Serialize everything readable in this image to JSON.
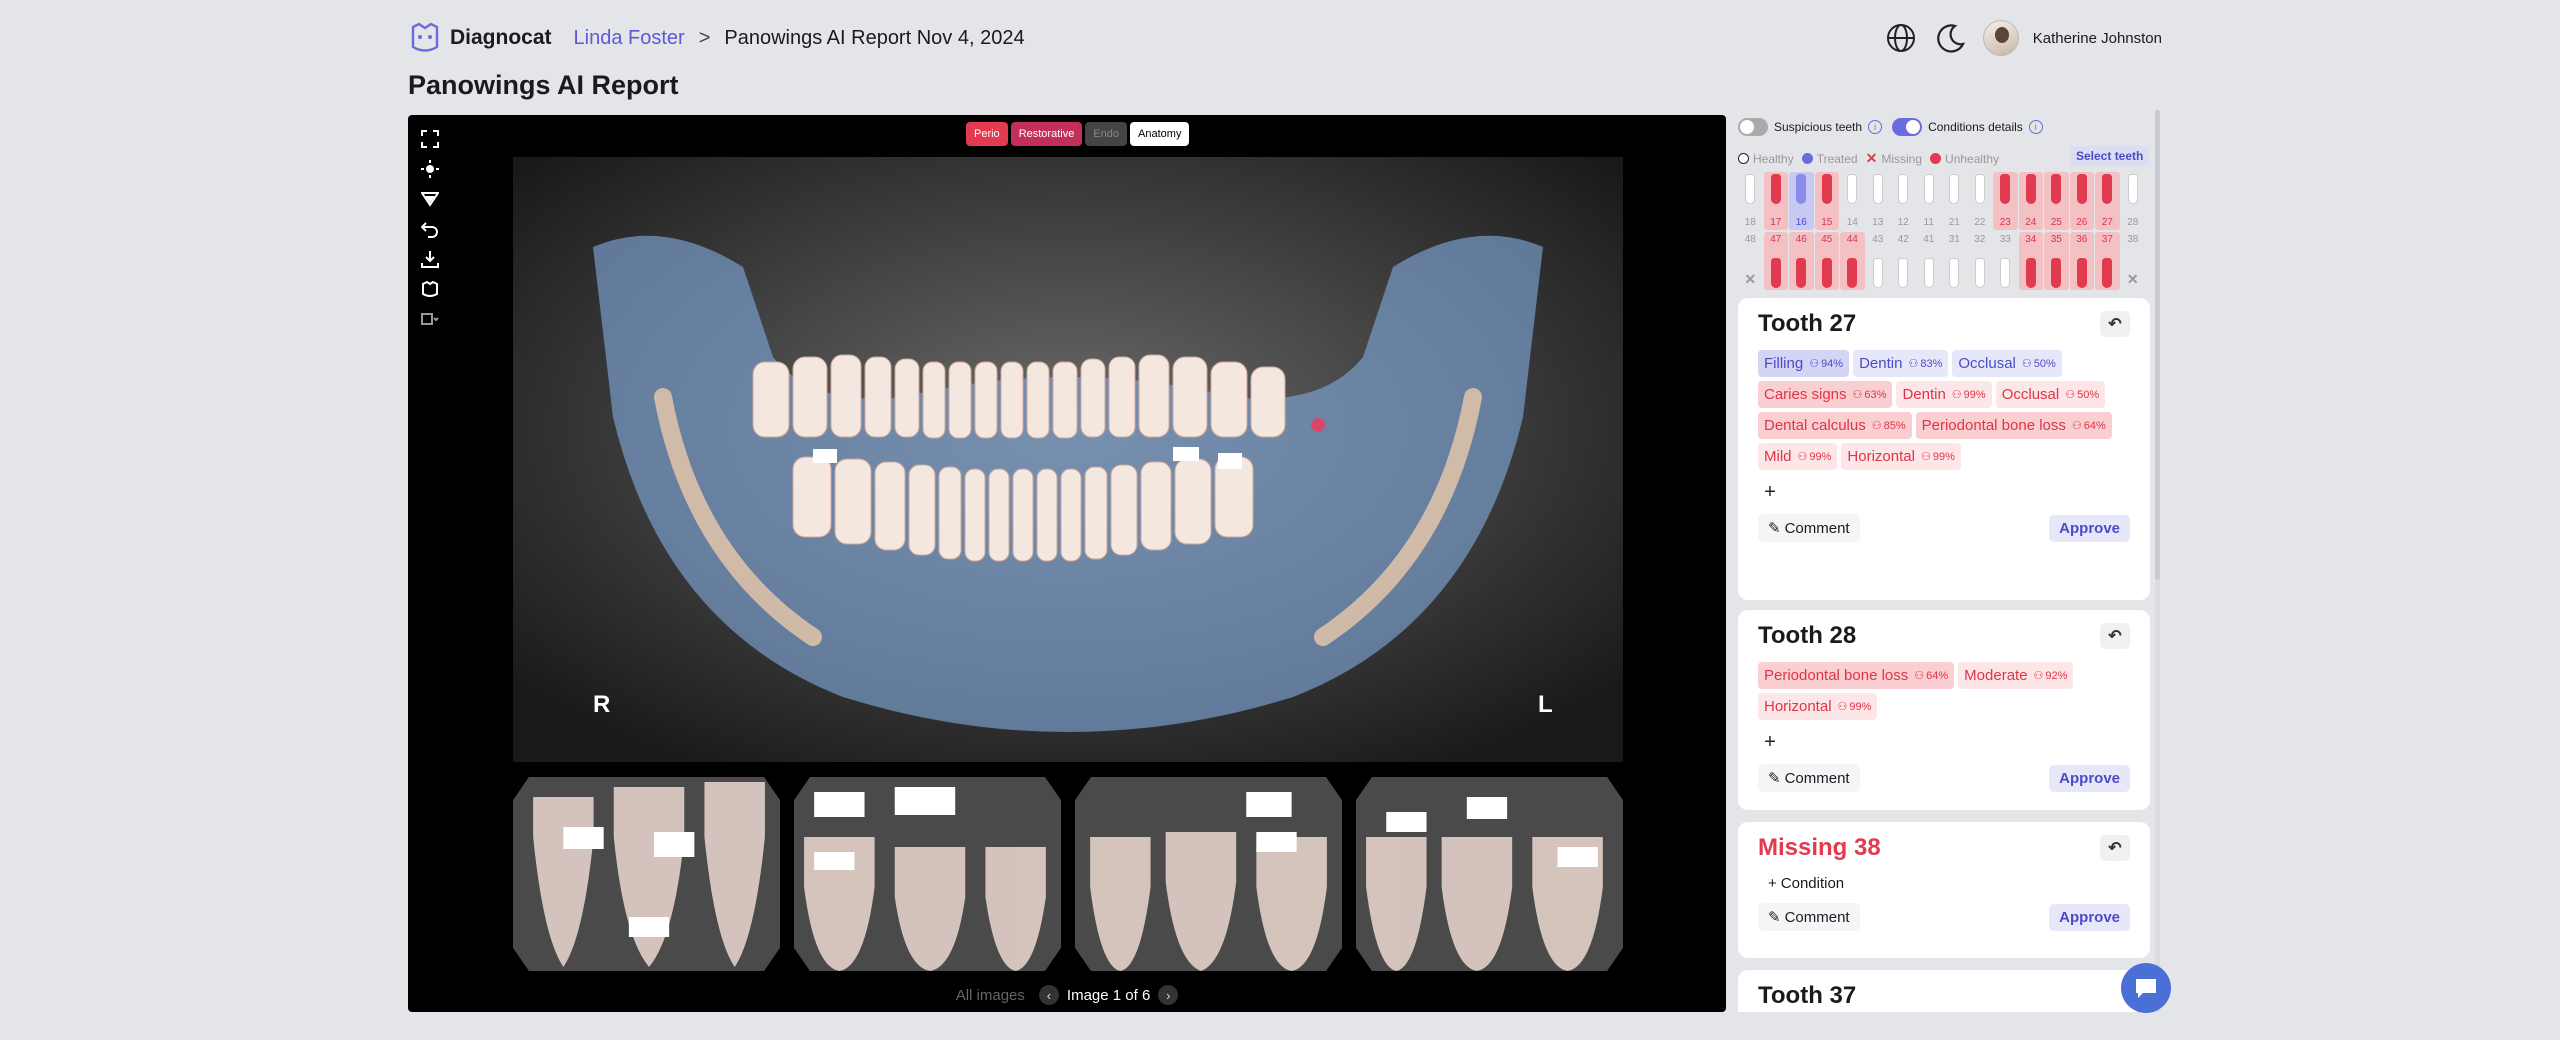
{
  "header": {
    "brand": "Diagnocat",
    "patient": "Linda Foster",
    "separator": ">",
    "report_crumb": "Panowings AI Report Nov 4, 2024",
    "user_name": "Katherine Johnston"
  },
  "page": {
    "title": "Panowings AI Report"
  },
  "viewer": {
    "modes": [
      {
        "label": "Perio",
        "color": "#e23a4e"
      },
      {
        "label": "Restorative",
        "color": "#c2305a"
      },
      {
        "label": "Endo",
        "color": "#444444"
      },
      {
        "label": "Anatomy",
        "color": "#ffffff"
      }
    ],
    "tools": [
      "expand-icon",
      "brightness-icon",
      "filter-icon",
      "undo-icon",
      "download-icon",
      "ai-toggle-icon",
      "split-view-icon"
    ],
    "xray_labels": {
      "right": "R",
      "left": "L"
    },
    "pager": {
      "all_images": "All images",
      "current": "Image 1 of 6"
    }
  },
  "sidebar": {
    "toggles": [
      {
        "label": "Suspicious teeth",
        "on": false
      },
      {
        "label": "Conditions details",
        "on": true
      }
    ],
    "legend": [
      {
        "label": "Healthy",
        "color": "#ffffff"
      },
      {
        "label": "Treated",
        "color": "#6b6be0"
      },
      {
        "label": "Missing",
        "color": "#e23a4e"
      },
      {
        "label": "Unhealthy",
        "color": "#e23a4e"
      }
    ],
    "select_teeth": "Select teeth",
    "upper_teeth": [
      {
        "n": "18",
        "s": "h"
      },
      {
        "n": "17",
        "s": "r"
      },
      {
        "n": "16",
        "s": "b"
      },
      {
        "n": "15",
        "s": "r"
      },
      {
        "n": "14",
        "s": "h"
      },
      {
        "n": "13",
        "s": "h"
      },
      {
        "n": "12",
        "s": "h"
      },
      {
        "n": "11",
        "s": "h"
      },
      {
        "n": "21",
        "s": "h"
      },
      {
        "n": "22",
        "s": "h"
      },
      {
        "n": "23",
        "s": "r"
      },
      {
        "n": "24",
        "s": "r"
      },
      {
        "n": "25",
        "s": "r"
      },
      {
        "n": "26",
        "s": "r"
      },
      {
        "n": "27",
        "s": "r"
      },
      {
        "n": "28",
        "s": "h"
      }
    ],
    "lower_teeth": [
      {
        "n": "48",
        "s": "m"
      },
      {
        "n": "47",
        "s": "r"
      },
      {
        "n": "46",
        "s": "r"
      },
      {
        "n": "45",
        "s": "r"
      },
      {
        "n": "44",
        "s": "r"
      },
      {
        "n": "43",
        "s": "h"
      },
      {
        "n": "42",
        "s": "h"
      },
      {
        "n": "41",
        "s": "h"
      },
      {
        "n": "31",
        "s": "h"
      },
      {
        "n": "32",
        "s": "h"
      },
      {
        "n": "33",
        "s": "h"
      },
      {
        "n": "34",
        "s": "r"
      },
      {
        "n": "35",
        "s": "r"
      },
      {
        "n": "36",
        "s": "r"
      },
      {
        "n": "37",
        "s": "r"
      },
      {
        "n": "38",
        "s": "m"
      }
    ]
  },
  "cards": {
    "tooth27": {
      "title": "Tooth 27",
      "chips": [
        {
          "label": "Filling",
          "pct": "94%",
          "kind": "blue strong"
        },
        {
          "label": "Dentin",
          "pct": "83%",
          "kind": "blue"
        },
        {
          "label": "Occlusal",
          "pct": "50%",
          "kind": "blue"
        },
        {
          "label": "Caries signs",
          "pct": "63%",
          "kind": "redc strong"
        },
        {
          "label": "Dentin",
          "pct": "99%",
          "kind": "redc"
        },
        {
          "label": "Occlusal",
          "pct": "50%",
          "kind": "redc"
        },
        {
          "label": "Dental calculus",
          "pct": "85%",
          "kind": "redc strong"
        },
        {
          "label": "Periodontal bone loss",
          "pct": "64%",
          "kind": "redc strong"
        },
        {
          "label": "Mild",
          "pct": "99%",
          "kind": "redc"
        },
        {
          "label": "Horizontal",
          "pct": "99%",
          "kind": "redc"
        }
      ],
      "comment": "Comment",
      "approve": "Approve"
    },
    "tooth28": {
      "title": "Tooth 28",
      "chips": [
        {
          "label": "Periodontal bone loss",
          "pct": "64%",
          "kind": "redc strong"
        },
        {
          "label": "Moderate",
          "pct": "92%",
          "kind": "redc"
        },
        {
          "label": "Horizontal",
          "pct": "99%",
          "kind": "redc"
        }
      ],
      "comment": "Comment",
      "approve": "Approve"
    },
    "missing38": {
      "title": "Missing 38",
      "condition": "Condition",
      "comment": "Comment",
      "approve": "Approve"
    },
    "tooth37": {
      "title": "Tooth 37"
    }
  }
}
